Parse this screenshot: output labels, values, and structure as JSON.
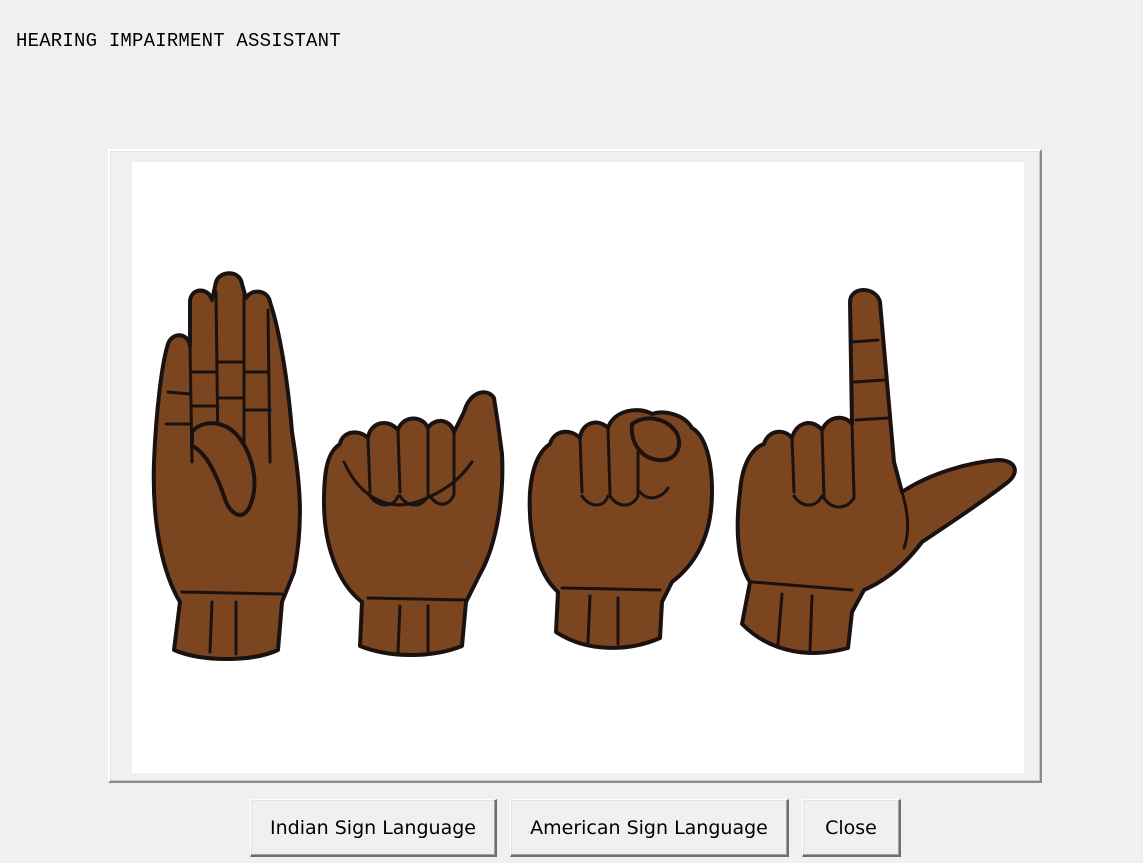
{
  "app": {
    "title": "HEARING IMPAIRMENT ASSISTANT"
  },
  "display": {
    "image": "asl-hand-signs-illustration",
    "hand_signs": [
      "flat-hand-sign",
      "fist-thumb-up-sign",
      "fist-index-curled-sign",
      "l-shape-sign"
    ],
    "skin_color": "#7b4520",
    "outline_color": "#1a1210"
  },
  "buttons": {
    "indian": "Indian Sign Language",
    "american": "American Sign Language",
    "close": "Close"
  },
  "colors": {
    "window_bg": "#f0f0f0",
    "image_bg": "#ffffff"
  }
}
